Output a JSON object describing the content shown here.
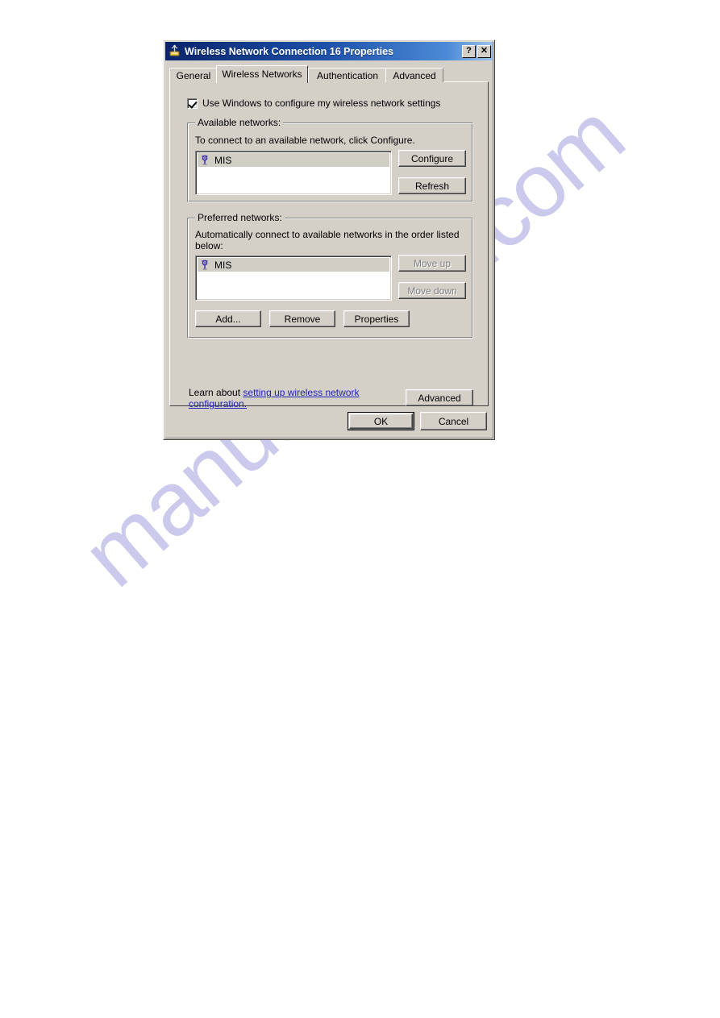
{
  "window": {
    "title": "Wireless Network Connection 16 Properties",
    "icon": "wireless-network-icon",
    "help_button": "?",
    "close_button": "✕",
    "titlebar_color_start": "#0a246a",
    "titlebar_color_end": "#a6caeb"
  },
  "tabs": [
    {
      "label": "General",
      "selected": false
    },
    {
      "label": "Wireless Networks",
      "selected": true
    },
    {
      "label": "Authentication",
      "selected": false
    },
    {
      "label": "Advanced",
      "selected": false
    }
  ],
  "use_windows_checkbox": {
    "label": "Use Windows to configure my wireless network settings",
    "checked": true
  },
  "available_networks": {
    "group_title": "Available networks:",
    "description": "To connect to an available network, click Configure.",
    "items": [
      {
        "name": "MIS",
        "icon": "wireless-signal-icon",
        "selected": true
      }
    ],
    "buttons": [
      {
        "label": "Configure",
        "disabled": false
      },
      {
        "label": "Refresh",
        "disabled": false
      }
    ]
  },
  "preferred_networks": {
    "group_title": "Preferred networks:",
    "description_line1": "Automatically connect to available networks in the order listed",
    "description_line2": "below:",
    "items": [
      {
        "name": "MIS",
        "icon": "wireless-signal-icon",
        "selected": true
      }
    ],
    "side_buttons": [
      {
        "label": "Move up",
        "disabled": true
      },
      {
        "label": "Move down",
        "disabled": true
      }
    ],
    "bottom_buttons": [
      {
        "label": "Add...",
        "disabled": false
      },
      {
        "label": "Remove",
        "disabled": false
      },
      {
        "label": "Properties",
        "disabled": false
      }
    ]
  },
  "learn_about": {
    "prefix": "Learn about ",
    "link_text": "setting up wireless network configuration.",
    "link_color": "#2222bb",
    "advanced_button": "Advanced"
  },
  "dialog_buttons": [
    {
      "label": "OK",
      "default": true
    },
    {
      "label": "Cancel",
      "default": false
    }
  ],
  "watermark": {
    "text": "manualshive.com",
    "color": "#c7c6ec"
  }
}
